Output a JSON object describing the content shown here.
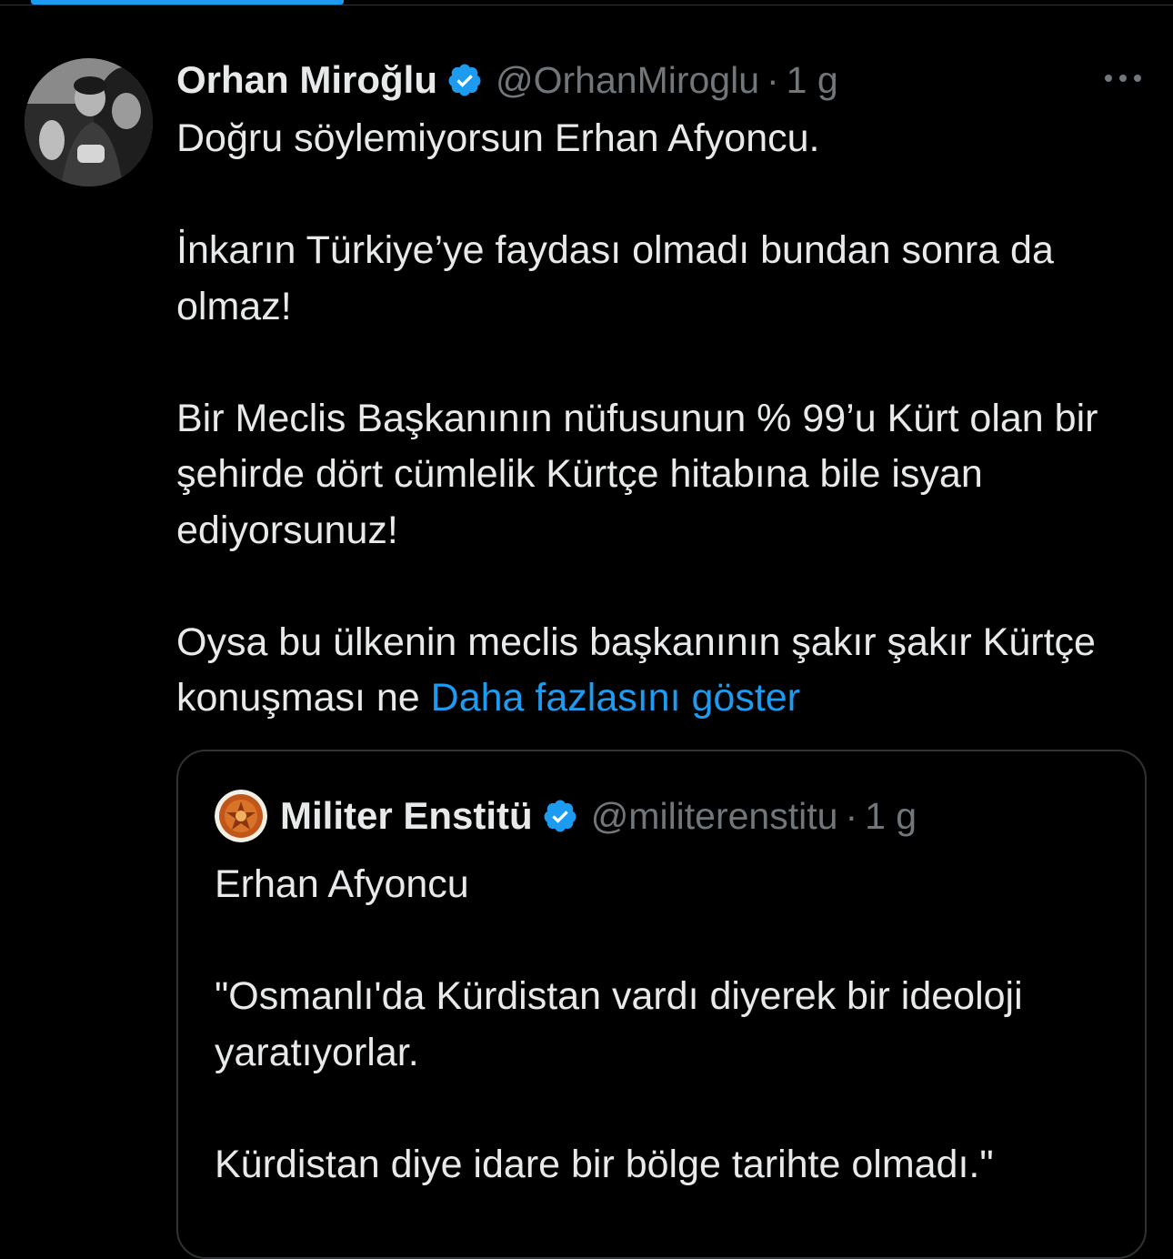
{
  "tweet": {
    "author": {
      "name": "Orhan Miroğlu",
      "handle": "@OrhanMiroglu",
      "verified": true,
      "avatar_icon": "profile-photo"
    },
    "separator": "·",
    "time": "1 g",
    "more_icon": "more-dots-icon",
    "paragraphs": [
      "Doğru söylemiyorsun Erhan Afyoncu.",
      "İnkarın Türkiye’ye faydası olmadı bundan sonra da olmaz!",
      "Bir Meclis Başkanının nüfusunun % 99’u Kürt olan bir şehirde dört cümlelik Kürtçe hitabına bile isyan ediyorsunuz!"
    ],
    "last_paragraph": "Oysa bu ülkenin meclis başkanının şakır şakır Kürtçe konuşması ne ",
    "show_more": "Daha fazlasını göster"
  },
  "quote": {
    "author": {
      "name": "Militer Enstitü",
      "handle": "@militerenstitu",
      "verified": true,
      "avatar_icon": "emblem-logo"
    },
    "separator": "·",
    "time": "1 g",
    "paragraphs": [
      "Erhan Afyoncu",
      "\"Osmanlı'da Kürdistan vardı diyerek bir ideoloji yaratıyorlar.",
      "Kürdistan diye idare bir bölge tarihte olmadı.\""
    ]
  },
  "colors": {
    "background": "#000000",
    "text": "#e7e9ea",
    "muted": "#71767b",
    "accent": "#1d9bf0",
    "border": "#2f3336"
  }
}
